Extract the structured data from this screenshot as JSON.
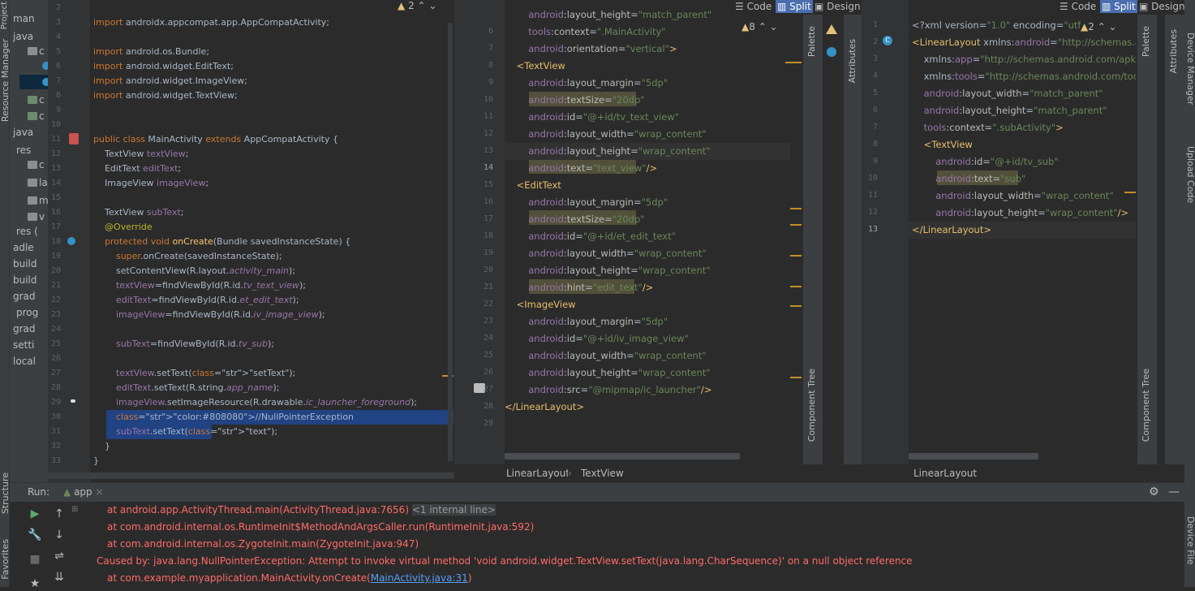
{
  "left_strip": {
    "project_label": "Project",
    "resource_manager": "Resource Manager",
    "structure": "Structure",
    "favorites": "Favorites"
  },
  "tree": {
    "items": [
      "man",
      "java",
      "c",
      "",
      "",
      "c",
      "c",
      "java",
      "res",
      "c",
      "la",
      "m",
      "m",
      "v",
      "res (",
      "adle",
      "build",
      "build",
      "grad",
      "prog",
      "grad",
      "setti",
      "local"
    ]
  },
  "editor1": {
    "warnings": "2",
    "line_numbers": [
      "2",
      "3",
      "4",
      "5",
      "6",
      "7",
      "8",
      "9",
      "10",
      "11",
      "12",
      "13",
      "14",
      "15",
      "16",
      "17",
      "18",
      "19",
      "20",
      "21",
      "22",
      "23",
      "24",
      "25",
      "26",
      "27",
      "28",
      "29",
      "30",
      "31",
      "32",
      "33"
    ],
    "lines": [
      "",
      "import androidx.appcompat.app.AppCompatActivity;",
      "",
      "import android.os.Bundle;",
      "import android.widget.EditText;",
      "import android.widget.ImageView;",
      "import android.widget.TextView;",
      "",
      "",
      "public class MainActivity extends AppCompatActivity {",
      "    TextView textView;",
      "    EditText editText;",
      "    ImageView imageView;",
      "",
      "    TextView subText;",
      "    @Override",
      "    protected void onCreate(Bundle savedInstanceState) {",
      "        super.onCreate(savedInstanceState);",
      "        setContentView(R.layout.activity_main);",
      "        textView=findViewById(R.id.tv_text_view);",
      "        editText=findViewById(R.id.et_edit_text);",
      "        imageView=findViewById(R.id.iv_image_view);",
      "",
      "        subText=findViewById(R.id.tv_sub);",
      "",
      "        textView.setText(\"setText\");",
      "        editText.setText(R.string.app_name);",
      "        imageView.setImageResource(R.drawable.ic_launcher_foreground);",
      "        //NullPointerException",
      "        subText.setText(\"text\");",
      "    }",
      "}"
    ]
  },
  "editor2": {
    "tabs": {
      "code": "Code",
      "split": "Split",
      "design": "Design"
    },
    "warnings": "8",
    "line_numbers": [
      "6",
      "7",
      "8",
      "9",
      "10",
      "11",
      "12",
      "13",
      "14",
      "15",
      "16",
      "17",
      "18",
      "19",
      "20",
      "21",
      "22",
      "23",
      "24",
      "25",
      "26",
      "27",
      "28",
      "29"
    ],
    "breadcrumb": [
      "LinearLayout",
      "TextView"
    ],
    "side_labels": {
      "palette": "Palette",
      "attributes": "Attributes",
      "component_tree": "Component Tree"
    }
  },
  "editor3": {
    "tabs": {
      "code": "Code",
      "split": "Split",
      "design": "Design"
    },
    "warnings": "2",
    "line_numbers": [
      "1",
      "2",
      "3",
      "4",
      "5",
      "6",
      "7",
      "8",
      "9",
      "10",
      "11",
      "12",
      "13"
    ],
    "breadcrumb": [
      "LinearLayout"
    ],
    "side_labels": {
      "palette": "Palette",
      "attributes": "Attributes",
      "component_tree": "Component Tree"
    },
    "right_labels": [
      "Device Manager",
      "Upload Code",
      "Device File"
    ]
  },
  "run": {
    "label": "Run:",
    "tab": "app",
    "lines": [
      "at android.app.ActivityThread.main(ActivityThread.java:7656)",
      "at com.android.internal.os.RuntimeInit$MethodAndArgsCaller.run(RuntimeInit.java:592)",
      "at com.android.internal.os.ZygoteInit.main(ZygoteInit.java:947)",
      "Caused by: java.lang.NullPointerException: Attempt to invoke virtual method 'void android.widget.TextView.setText(java.lang.CharSequence)' on a null object reference",
      "at com.example.myapplication.MainActivity.onCreate("
    ],
    "internal_line": "<1 internal line>",
    "link": "MainActivity.java:31",
    "close_paren": ")"
  },
  "colors": {
    "error": "#ff6b68",
    "keyword": "#cc7832",
    "string": "#6a8759",
    "selection": "#214283"
  }
}
